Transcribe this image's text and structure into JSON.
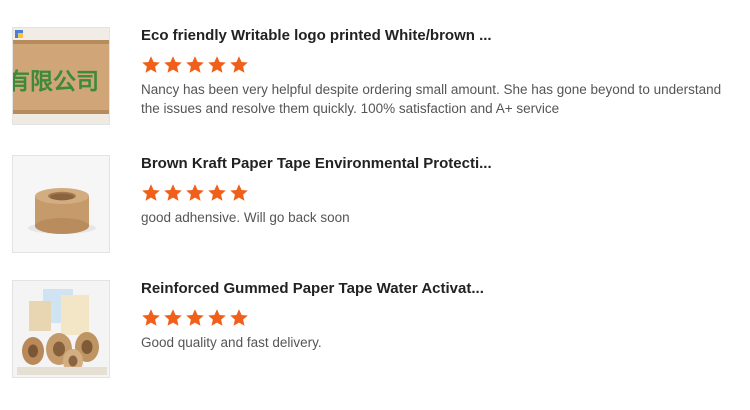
{
  "accent_color": "#f0601a",
  "reviews": [
    {
      "title": "Eco friendly Writable logo printed White/brown ...",
      "rating": 5,
      "rating_max": 5,
      "comment": "Nancy has been very helpful despite ordering small amount. She has gone beyond to understand the issues and resolve them quickly. 100% satisfaction and A+ service",
      "image": "kraft-tape-roll-printed-logo",
      "image_text": "有限公司"
    },
    {
      "title": "Brown Kraft Paper Tape Environmental Protecti...",
      "rating": 5,
      "rating_max": 5,
      "comment": "good adhensive. Will go back soon",
      "image": "brown-kraft-tape-roll"
    },
    {
      "title": "Reinforced Gummed Paper Tape Water Activat...",
      "rating": 5,
      "rating_max": 5,
      "comment": "Good quality and fast delivery.",
      "image": "gummed-paper-tape-rolls"
    }
  ]
}
